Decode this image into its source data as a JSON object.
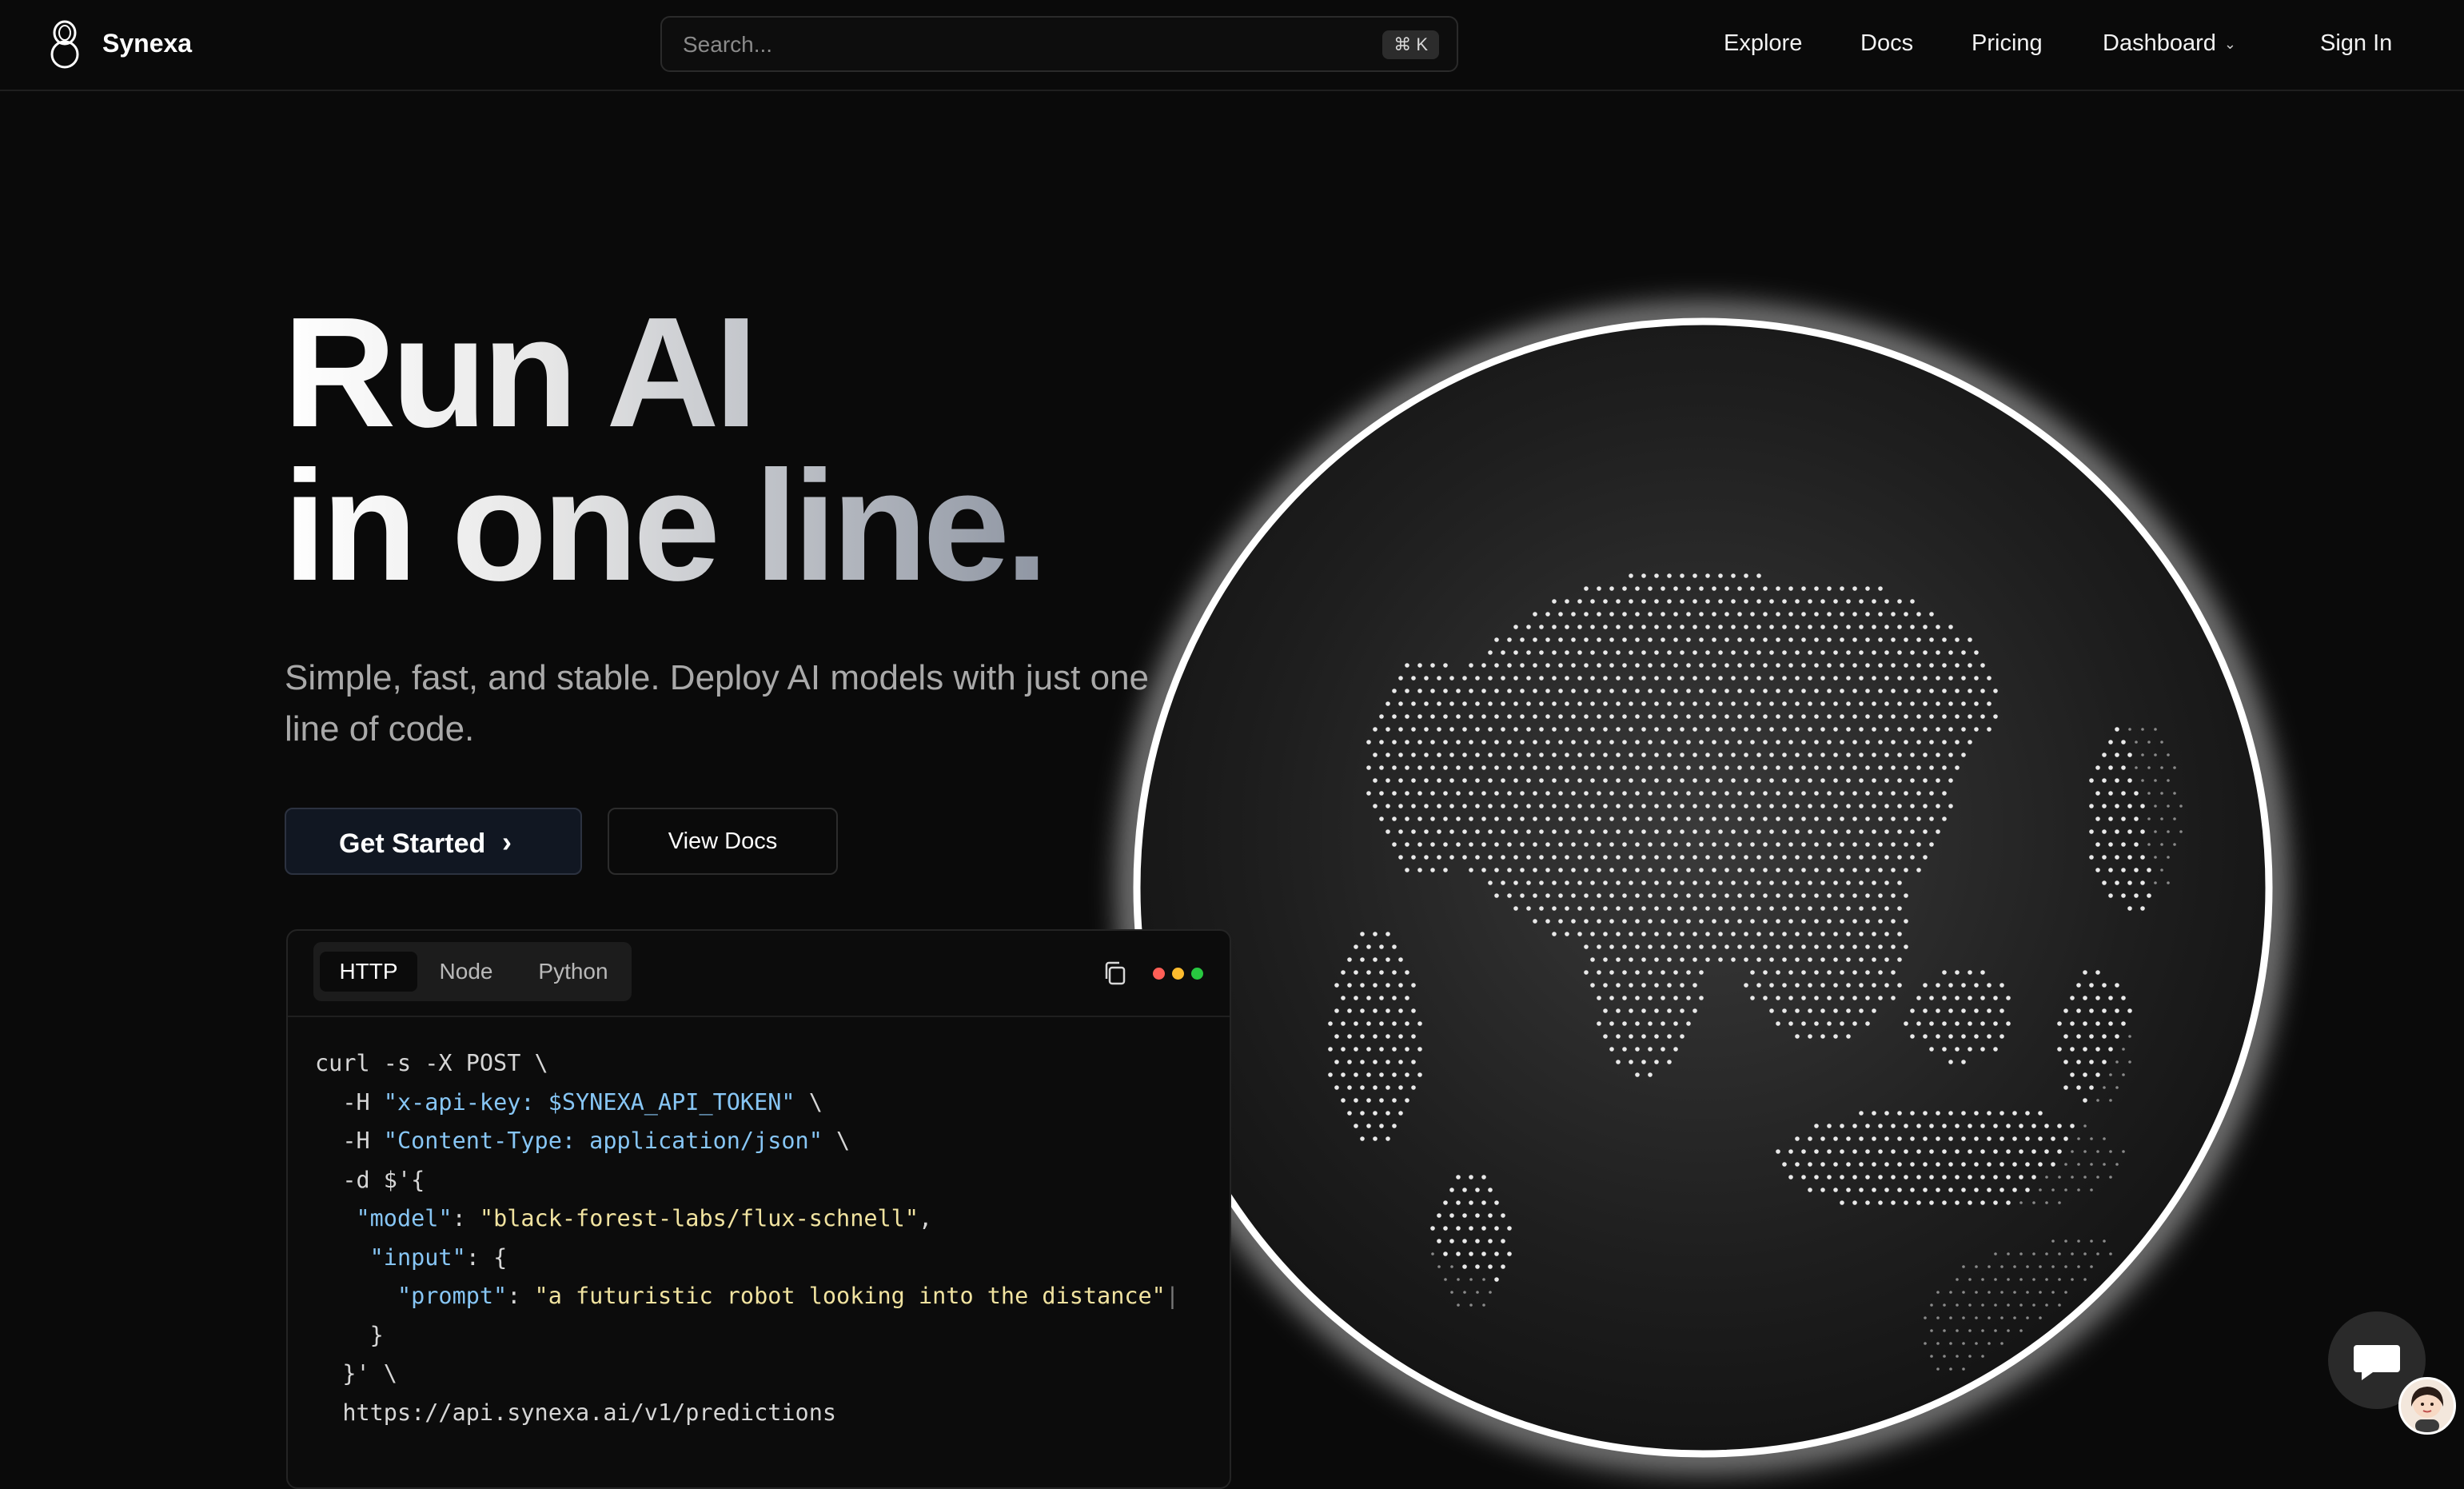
{
  "nav": {
    "brand": "Synexa",
    "search_placeholder": "Search...",
    "search_shortcut": "⌘ K",
    "links": [
      "Explore",
      "Docs",
      "Pricing",
      "Dashboard"
    ],
    "sign_in": "Sign In"
  },
  "hero": {
    "title_line1": "Run AI",
    "title_line2": "in one line.",
    "subtitle": "Simple, fast, and stable. Deploy AI models with just one line of code.",
    "primary_button": "Get Started",
    "secondary_button": "View Docs"
  },
  "code_card": {
    "tabs": [
      "HTTP",
      "Node",
      "Python"
    ],
    "active_tab": "HTTP",
    "window_dot_colors": [
      "#ff5f57",
      "#febc2e",
      "#28c840"
    ],
    "lines": {
      "l1": "curl -s -X POST \\",
      "l2_flag": "  -H ",
      "l2_str": "\"x-api-key: $SYNEXA_API_TOKEN\"",
      "l2_end": " \\",
      "l3_flag": "  -H ",
      "l3_str": "\"Content-Type: application/json\"",
      "l3_end": " \\",
      "l4": "  -d $'{",
      "l5_key": "   \"model\"",
      "l5_sep": ": ",
      "l5_val": "\"black-forest-labs/flux-schnell\"",
      "l5_end": ",",
      "l6_key": "    \"input\"",
      "l6_end": ": {",
      "l7_key": "      \"prompt\"",
      "l7_sep": ": ",
      "l7_val": "\"a futuristic robot looking into the distance\"",
      "l7_caret": "|",
      "l8": "    }",
      "l9": "  }' \\",
      "l10": "  https://api.synexa.ai/v1/predictions"
    }
  },
  "colors": {
    "background": "#0a0a0a",
    "code_string": "#87c6f5",
    "code_value": "#f1e3a0"
  }
}
